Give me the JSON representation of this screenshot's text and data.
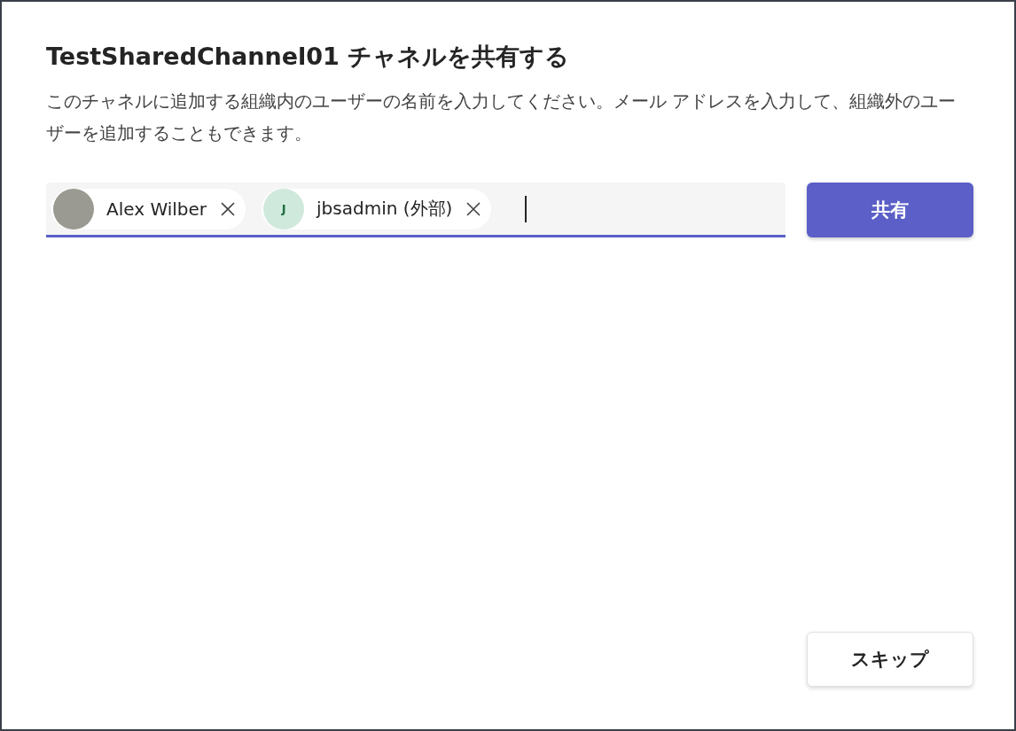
{
  "dialog": {
    "title": "TestSharedChannel01 チャネルを共有する",
    "description": "このチャネルに追加する組織内のユーザーの名前を入力してください。メール アドレスを入力して、組織外のユーザーを追加することもできます。",
    "people_field": {
      "chips": [
        {
          "kind": "photo",
          "name": "Alex Wilber"
        },
        {
          "kind": "initials",
          "initial": "J",
          "name": "jbsadmin (外部)"
        }
      ],
      "focused": true
    },
    "share_button": "共有",
    "skip_button": "スキップ"
  }
}
